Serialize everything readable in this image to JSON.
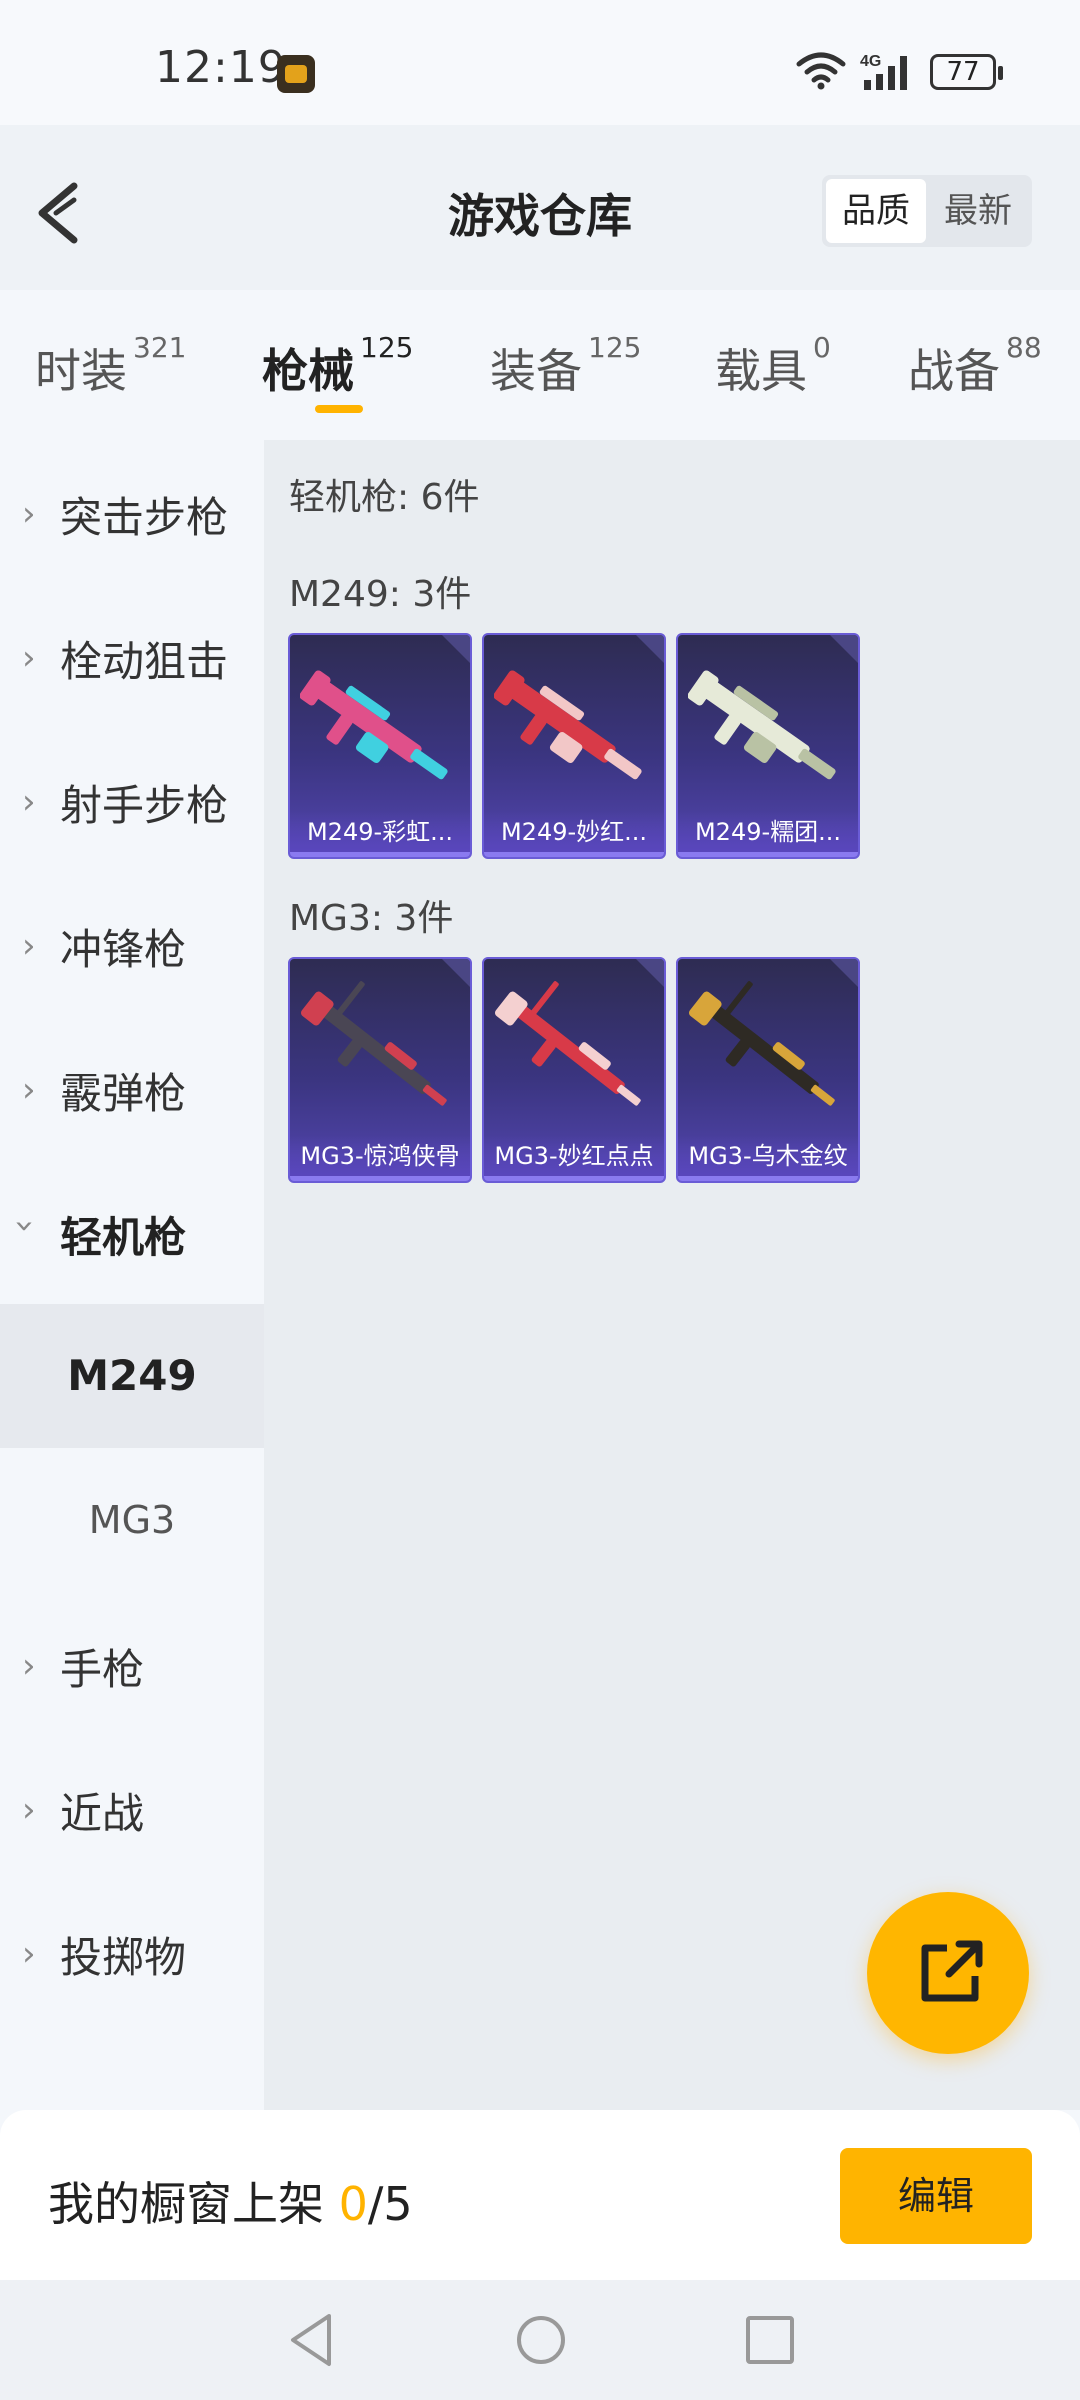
{
  "status": {
    "time": "12:19",
    "network": "4G",
    "battery": "77"
  },
  "header": {
    "title": "游戏仓库",
    "sort_options": [
      "品质",
      "最新"
    ],
    "sort_selected": "品质"
  },
  "tabs": [
    {
      "label": "时装",
      "count": "321"
    },
    {
      "label": "枪械",
      "count": "125",
      "active": true
    },
    {
      "label": "装备",
      "count": "125"
    },
    {
      "label": "载具",
      "count": "0"
    },
    {
      "label": "战备",
      "count": "88"
    }
  ],
  "sidebar": {
    "categories": [
      {
        "label": "突击步枪"
      },
      {
        "label": "栓动狙击"
      },
      {
        "label": "射手步枪"
      },
      {
        "label": "冲锋枪"
      },
      {
        "label": "霰弹枪"
      },
      {
        "label": "轻机枪",
        "open": true
      },
      {
        "label": "手枪"
      },
      {
        "label": "近战"
      },
      {
        "label": "投掷物"
      }
    ],
    "subcategories": [
      {
        "label": "M249",
        "selected": true
      },
      {
        "label": "MG3"
      }
    ]
  },
  "main": {
    "summary": "轻机枪: 6件",
    "groups": [
      {
        "title": "M249: 3件",
        "items": [
          {
            "name": "M249-彩虹...",
            "color": "#e0508a",
            "accent": "#40d0e0"
          },
          {
            "name": "M249-妙红...",
            "color": "#d83a48",
            "accent": "#f2c7c7"
          },
          {
            "name": "M249-糯团...",
            "color": "#e6ead8",
            "accent": "#b9c2a4"
          }
        ]
      },
      {
        "title": "MG3: 3件",
        "items": [
          {
            "name": "MG3-惊鸿侠骨",
            "color": "#4a4654",
            "accent": "#d04050"
          },
          {
            "name": "MG3-妙红点点",
            "color": "#d83a48",
            "accent": "#f4d0d0"
          },
          {
            "name": "MG3-乌木金纹",
            "color": "#2e2a24",
            "accent": "#d8a53a"
          }
        ]
      }
    ]
  },
  "bottom": {
    "showcase_label": "我的橱窗上架",
    "showcase_current": "0",
    "showcase_total": "/5",
    "edit_label": "编辑"
  }
}
